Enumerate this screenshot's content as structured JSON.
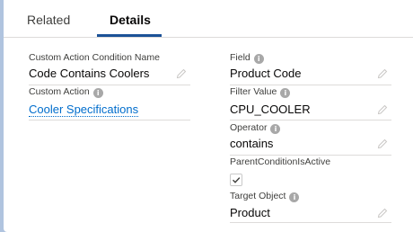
{
  "tabs": [
    {
      "label": "Related"
    },
    {
      "label": "Details"
    }
  ],
  "left_fields": [
    {
      "label": "Custom Action Condition Name",
      "value": "Code Contains Coolers"
    },
    {
      "label": "Custom Action",
      "value": "Cooler Specifications"
    }
  ],
  "right_fields": [
    {
      "label": "Field",
      "value": "Product Code"
    },
    {
      "label": "Filter Value",
      "value": "CPU_COOLER"
    },
    {
      "label": "Operator",
      "value": "contains"
    },
    {
      "label": "ParentConditionIsActive",
      "checked": true
    },
    {
      "label": "Target Object",
      "value": "Product"
    }
  ],
  "icons": {
    "info": "info-icon",
    "edit": "pencil-icon",
    "check": "checkmark-icon"
  },
  "colors": {
    "link": "#006dcc",
    "active_tab_underline": "#1b5297",
    "background": "#b0c4df"
  }
}
